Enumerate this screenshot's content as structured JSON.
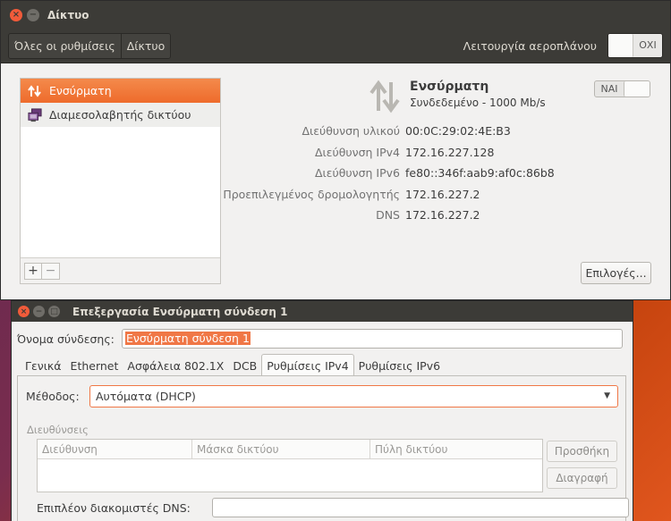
{
  "main_window": {
    "title": "Δίκτυο",
    "nav": {
      "all_settings": "Όλες οι ρυθμίσεις",
      "network": "Δίκτυο"
    },
    "airplane": {
      "label": "Λειτουργία αεροπλάνου",
      "state": "ΟΧΙ"
    },
    "devices": [
      {
        "label": "Ενσύρματη",
        "icon": "wired-arrows-icon"
      },
      {
        "label": "Διαμεσολαβητής δικτύου",
        "icon": "network-proxy-icon"
      }
    ],
    "add_symbol": "+",
    "remove_symbol": "−",
    "detail": {
      "title": "Ενσύρματη",
      "status": "Συνδεδεμένο - 1000 Mb/s",
      "switch_state": "ΝΑΙ",
      "rows": [
        {
          "key": "Διεύθυνση υλικού",
          "value": "00:0C:29:02:4E:B3"
        },
        {
          "key": "Διεύθυνση IPv4",
          "value": "172.16.227.128"
        },
        {
          "key": "Διεύθυνση IPv6",
          "value": "fe80::346f:aab9:af0c:86b8"
        },
        {
          "key": "Προεπιλεγμένος δρομολογητής",
          "value": "172.16.227.2"
        },
        {
          "key": "DNS",
          "value": "172.16.227.2"
        }
      ],
      "options_label": "Επιλογές..."
    }
  },
  "edit_window": {
    "title": "Επεξεργασία Ενσύρματη σύνδεση 1",
    "conn_name_label": "Όνομα σύνδεσης:",
    "conn_name_value": "Ενσύρματη σύνδεση 1",
    "tabs": [
      "Γενικά",
      "Ethernet",
      "Ασφάλεια 802.1X",
      "DCB",
      "Ρυθμίσεις IPv4",
      "Ρυθμίσεις IPv6"
    ],
    "selected_tab": "Ρυθμίσεις IPv4",
    "method_label": "Μέθοδος:",
    "method_value": "Αυτόματα (DHCP)",
    "addresses_label": "Διευθύνσεις",
    "columns": [
      "Διεύθυνση",
      "Μάσκα δικτύου",
      "Πύλη δικτύου"
    ],
    "add_label": "Προσθήκη",
    "delete_label": "Διαγραφή",
    "dns_label": "Επιπλέον διακομιστές DNS:",
    "dns_value": ""
  },
  "colors": {
    "accent": "#f07746",
    "titlebar": "#3c3b37",
    "close": "#f15b3a"
  }
}
